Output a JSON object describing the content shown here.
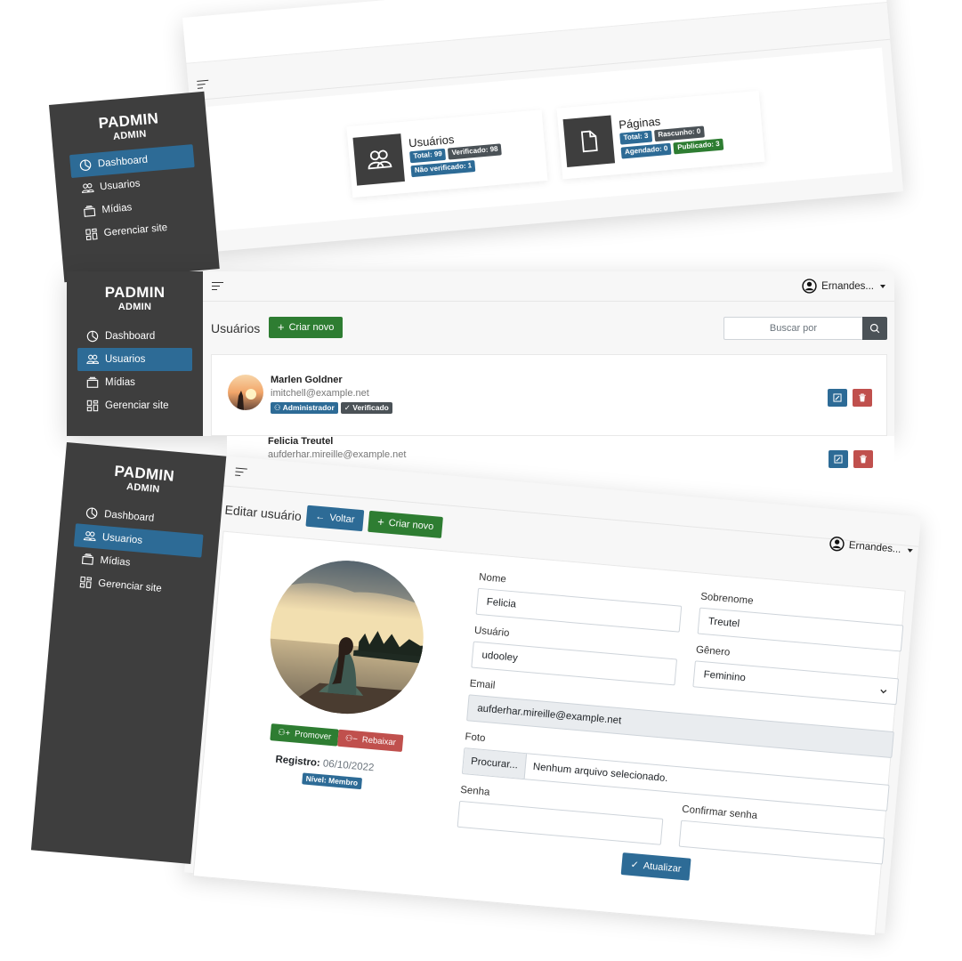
{
  "brand": {
    "title": "PADMIN",
    "subtitle": "ADMIN"
  },
  "nav": {
    "dashboard": "Dashboard",
    "users": "Usuarios",
    "media": "Mídias",
    "site": "Gerenciar site"
  },
  "user_menu": {
    "label": "Ernandes..."
  },
  "dashboard": {
    "users_card": {
      "title": "Usuários",
      "total": "Total: 99",
      "verified": "Verificado: 98",
      "unverified": "Não verificado: 1"
    },
    "pages_card": {
      "title": "Páginas",
      "total": "Total: 3",
      "draft": "Rascunho: 0",
      "scheduled": "Agendado: 0",
      "published": "Publicado: 3"
    }
  },
  "users_list": {
    "heading": "Usuários",
    "create_label": "Criar novo",
    "search_placeholder": "Buscar por",
    "rows": [
      {
        "name": "Marlen Goldner",
        "email": "imitchell@example.net",
        "role": "Administrador",
        "status": "Verificado"
      },
      {
        "name": "Felicia Treutel",
        "email": "aufderhar.mireille@example.net"
      }
    ]
  },
  "edit_user": {
    "heading": "Editar usuário",
    "back_label": "Voltar",
    "create_label": "Criar novo",
    "promote_label": "Promover",
    "demote_label": "Rebaixar",
    "registration_label": "Registro:",
    "registration_date": "06/10/2022",
    "level_badge": "Nível: Membro",
    "fields": {
      "first_name": {
        "label": "Nome",
        "value": "Felicia"
      },
      "last_name": {
        "label": "Sobrenome",
        "value": "Treutel"
      },
      "username": {
        "label": "Usuário",
        "value": "udooley"
      },
      "gender": {
        "label": "Gênero",
        "value": "Feminino"
      },
      "email": {
        "label": "Email",
        "value": "aufderhar.mireille@example.net"
      },
      "photo": {
        "label": "Foto",
        "button": "Procurar...",
        "value": "Nenhum arquivo selecionado."
      },
      "password": {
        "label": "Senha",
        "value": ""
      },
      "confirm_password": {
        "label": "Confirmar senha",
        "value": ""
      }
    },
    "submit_label": "Atualizar"
  },
  "colors": {
    "sidebar": "#3e3e3e",
    "primary": "#2d6b96",
    "success": "#2e7d32",
    "danger": "#c0504d",
    "secondary": "#4b5257"
  },
  "icons": [
    "hamburger-icon",
    "user-circle-icon",
    "dashboard-icon",
    "users-icon",
    "media-icon",
    "layout-icon",
    "file-icon",
    "search-icon",
    "plus-icon",
    "edit-icon",
    "trash-icon",
    "arrow-left-icon",
    "check-icon",
    "user-plus-icon",
    "user-minus-icon",
    "chevron-down-icon"
  ]
}
